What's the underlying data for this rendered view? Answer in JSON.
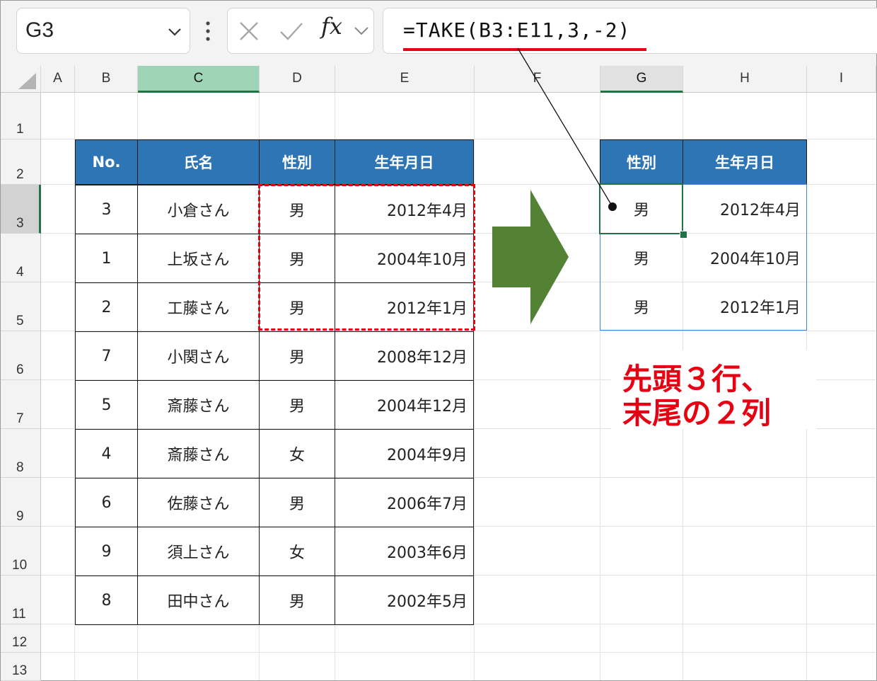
{
  "formula_bar": {
    "name_box": "G3",
    "fx_label": "fx",
    "formula": "=TAKE(B3:E11,3,-2)"
  },
  "columns": [
    "A",
    "B",
    "C",
    "D",
    "E",
    "F",
    "G",
    "H",
    "I"
  ],
  "rows": [
    "1",
    "2",
    "3",
    "4",
    "5",
    "6",
    "7",
    "8",
    "9",
    "10",
    "11",
    "12",
    "13"
  ],
  "source_table": {
    "headers": [
      "No.",
      "氏名",
      "性別",
      "生年月日"
    ],
    "rows": [
      [
        "3",
        "小倉さん",
        "男",
        "2012年4月"
      ],
      [
        "1",
        "上坂さん",
        "男",
        "2004年10月"
      ],
      [
        "2",
        "工藤さん",
        "男",
        "2012年1月"
      ],
      [
        "7",
        "小関さん",
        "男",
        "2008年12月"
      ],
      [
        "5",
        "斎藤さん",
        "男",
        "2004年12月"
      ],
      [
        "4",
        "斎藤さん",
        "女",
        "2004年9月"
      ],
      [
        "6",
        "佐藤さん",
        "男",
        "2006年7月"
      ],
      [
        "9",
        "須上さん",
        "女",
        "2003年6月"
      ],
      [
        "8",
        "田中さん",
        "男",
        "2002年5月"
      ]
    ]
  },
  "result_table": {
    "headers": [
      "性別",
      "生年月日"
    ],
    "rows": [
      [
        "男",
        "2012年4月"
      ],
      [
        "男",
        "2004年10月"
      ],
      [
        "男",
        "2012年1月"
      ]
    ]
  },
  "annotation": {
    "line1": "先頭３行、",
    "line2": "末尾の２列",
    "color": "#e60012"
  },
  "colors": {
    "header_fill": "#2e75b6",
    "arrow": "#548235",
    "selection": "#217346",
    "highlight_dash": "#e60012"
  }
}
